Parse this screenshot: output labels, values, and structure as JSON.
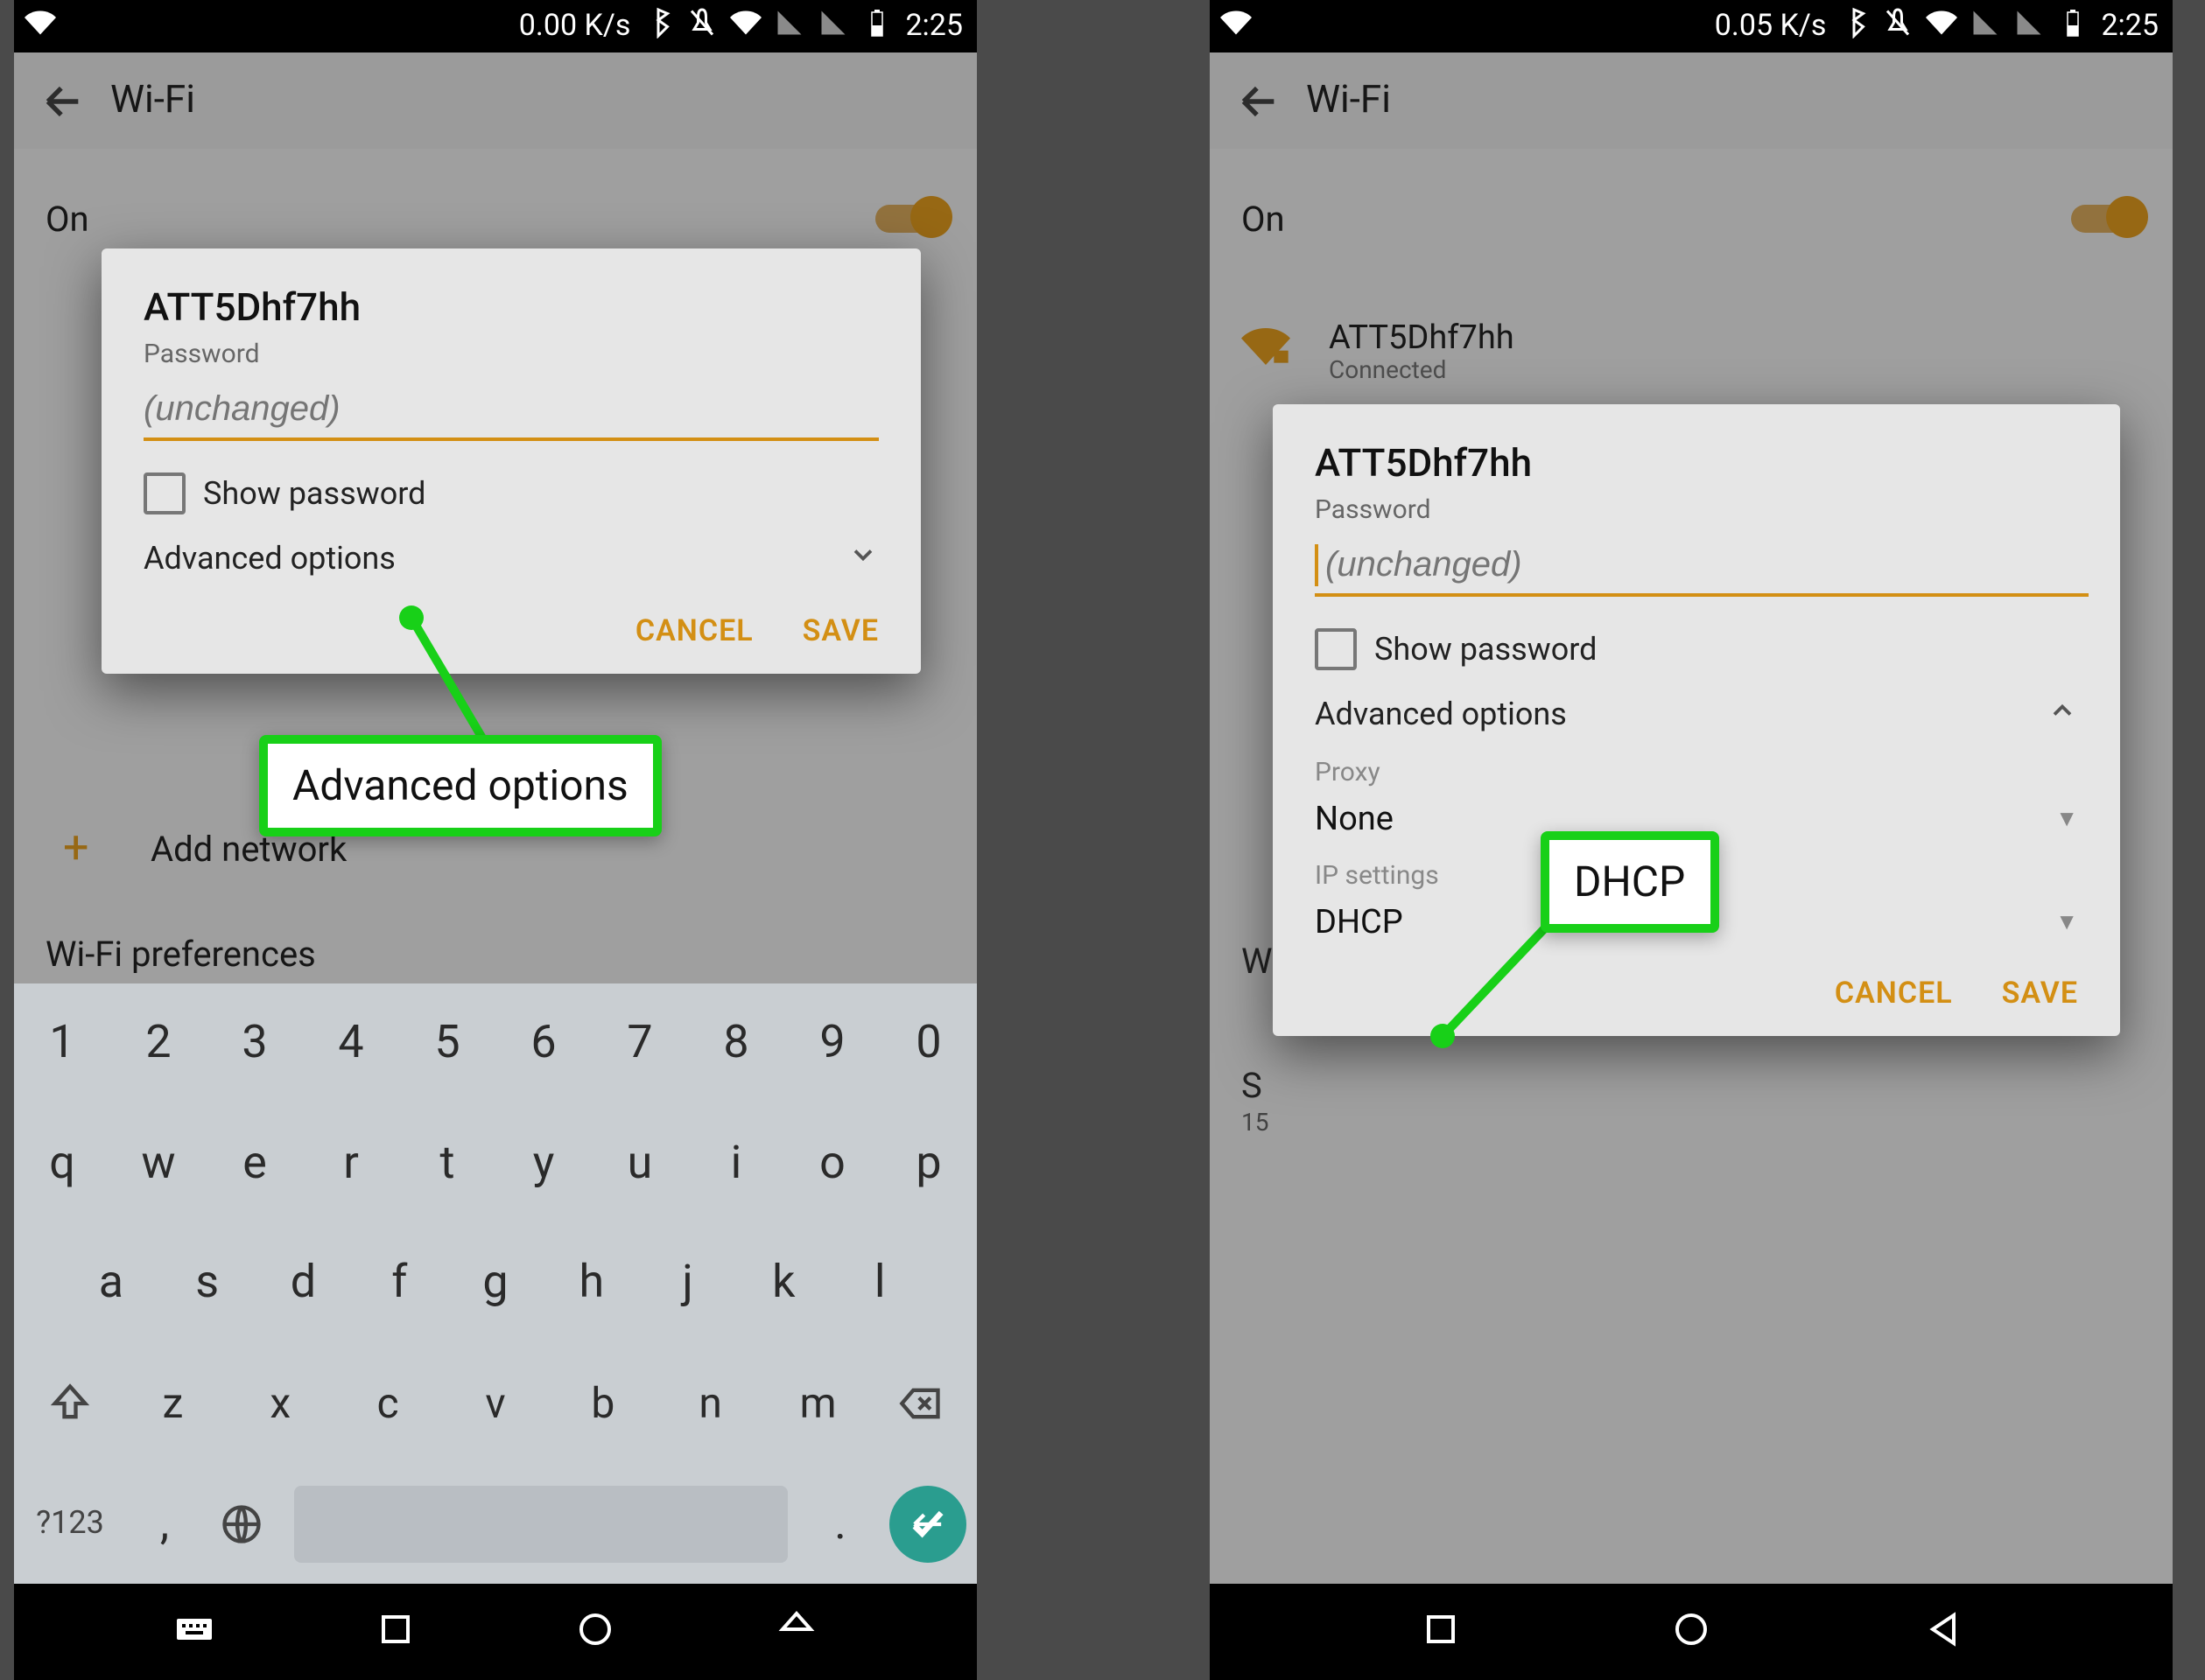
{
  "status": {
    "left_rate": "0.00 K/s",
    "right_rate": "0.05 K/s",
    "time": "2:25"
  },
  "titlebar": {
    "title": "Wi-Fi"
  },
  "toggle": {
    "label": "On"
  },
  "network": {
    "ssid": "ATT5Dhf7hh",
    "status": "Connected"
  },
  "dialog": {
    "ssid": "ATT5Dhf7hh",
    "password_label": "Password",
    "password_placeholder": "(unchanged)",
    "show_password": "Show password",
    "advanced": "Advanced options",
    "proxy_label": "Proxy",
    "proxy_value": "None",
    "ip_label": "IP settings",
    "ip_value": "DHCP",
    "cancel": "CANCEL",
    "save": "SAVE"
  },
  "left_extra": {
    "add_network": "Add network",
    "wifi_prefs": "Wi-Fi preferences"
  },
  "right_extra": {
    "row_w": "W",
    "row_s": "S",
    "row_s_sub": "15"
  },
  "keyboard": {
    "r1": [
      "1",
      "2",
      "3",
      "4",
      "5",
      "6",
      "7",
      "8",
      "9",
      "0"
    ],
    "r2": [
      "q",
      "w",
      "e",
      "r",
      "t",
      "y",
      "u",
      "i",
      "o",
      "p"
    ],
    "r3": [
      "a",
      "s",
      "d",
      "f",
      "g",
      "h",
      "j",
      "k",
      "l"
    ],
    "r4": [
      "z",
      "x",
      "c",
      "v",
      "b",
      "n",
      "m"
    ],
    "sym": "?123",
    "comma": ",",
    "period": "."
  },
  "callouts": {
    "advanced": "Advanced options",
    "dhcp": "DHCP"
  }
}
